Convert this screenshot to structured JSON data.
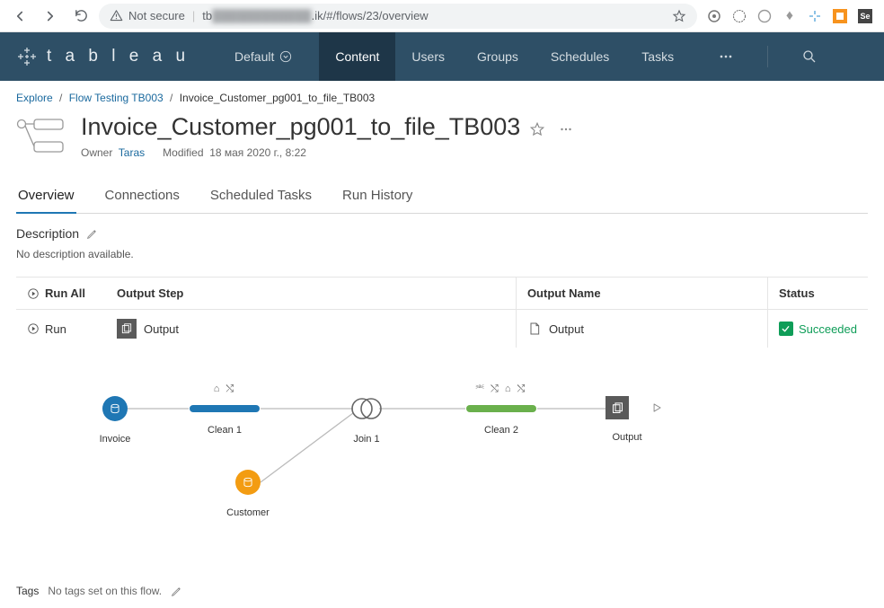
{
  "browser": {
    "not_secure": "Not secure",
    "url_prefix": "tb",
    "url_suffix": ".ik/#/flows/23/overview"
  },
  "header": {
    "logo_text": "t a b l e a u",
    "site": "Default",
    "nav": [
      "Content",
      "Users",
      "Groups",
      "Schedules",
      "Tasks"
    ],
    "active_nav": 0
  },
  "breadcrumb": {
    "items": [
      "Explore",
      "Flow Testing TB003",
      "Invoice_Customer_pg001_to_file_TB003"
    ]
  },
  "page": {
    "title": "Invoice_Customer_pg001_to_file_TB003",
    "owner_label": "Owner",
    "owner_name": "Taras",
    "modified_label": "Modified",
    "modified_value": "18 мая 2020 г., 8:22"
  },
  "tabs": [
    "Overview",
    "Connections",
    "Scheduled Tasks",
    "Run History"
  ],
  "active_tab": 0,
  "description": {
    "label": "Description",
    "text": "No description available."
  },
  "output_table": {
    "headers": {
      "run_all": "Run All",
      "output_step": "Output Step",
      "output_name": "Output Name",
      "status": "Status"
    },
    "row": {
      "run": "Run",
      "step": "Output",
      "name": "Output",
      "status": "Succeeded"
    }
  },
  "flow": {
    "nodes": {
      "invoice": "Invoice",
      "clean1": "Clean 1",
      "clean1_annot": "⌂ ⤭",
      "join1": "Join 1",
      "clean2": "Clean 2",
      "clean2_annot": "⎃ ⤭ ⌂ ⤭",
      "output": "Output",
      "customer": "Customer"
    }
  },
  "tags": {
    "label": "Tags",
    "text": "No tags set on this flow."
  }
}
